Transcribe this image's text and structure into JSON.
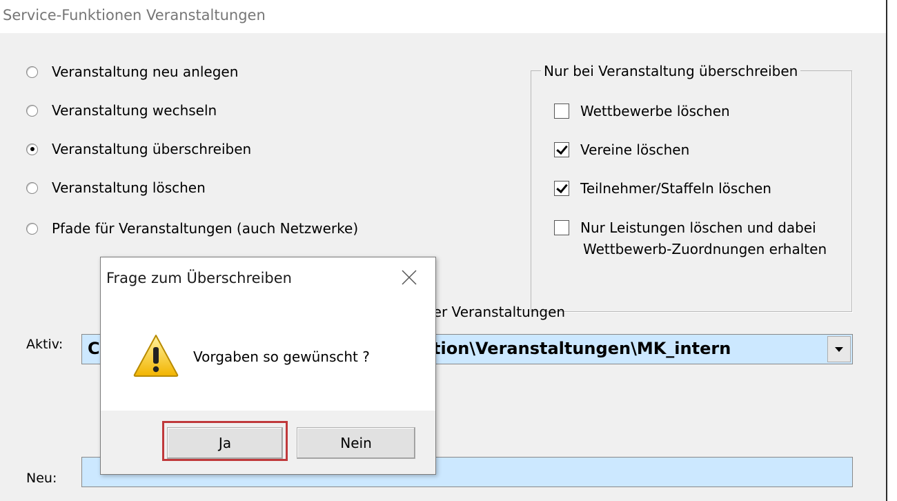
{
  "window": {
    "title": "Service-Funktionen Veranstaltungen"
  },
  "options": [
    {
      "label": "Veranstaltung neu anlegen",
      "checked": false
    },
    {
      "label": "Veranstaltung wechseln",
      "checked": false
    },
    {
      "label": "Veranstaltung überschreiben",
      "checked": true
    },
    {
      "label": "Veranstaltung löschen",
      "checked": false
    },
    {
      "label": "Pfade für Veranstaltungen (auch Netzwerke)",
      "checked": false
    }
  ],
  "overwrite_group": {
    "legend": "Nur bei Veranstaltung überschreiben",
    "items": [
      {
        "label": "Wettbewerbe löschen",
        "checked": false
      },
      {
        "label": "Vereine löschen",
        "checked": true
      },
      {
        "label": "Teilnehmer/Staffeln löschen",
        "checked": true
      },
      {
        "label": "Nur Leistungen löschen und dabei",
        "label2": "Wettbewerb-Zuordnungen erhalten",
        "checked": false
      }
    ]
  },
  "paths": {
    "section_label_visible": "dener Veranstaltungen",
    "aktiv_label": "Aktiv:",
    "aktiv_value_left": "C",
    "aktiv_value_right": "tion\\Veranstaltungen\\MK_intern",
    "neu_label": "Neu:"
  },
  "dialog": {
    "title": "Frage zum Überschreiben",
    "message": "Vorgaben so gewünscht ?",
    "yes_label": "Ja",
    "no_label": "Nein",
    "icon": "warning-icon",
    "highlight_color": "#c0393b"
  }
}
